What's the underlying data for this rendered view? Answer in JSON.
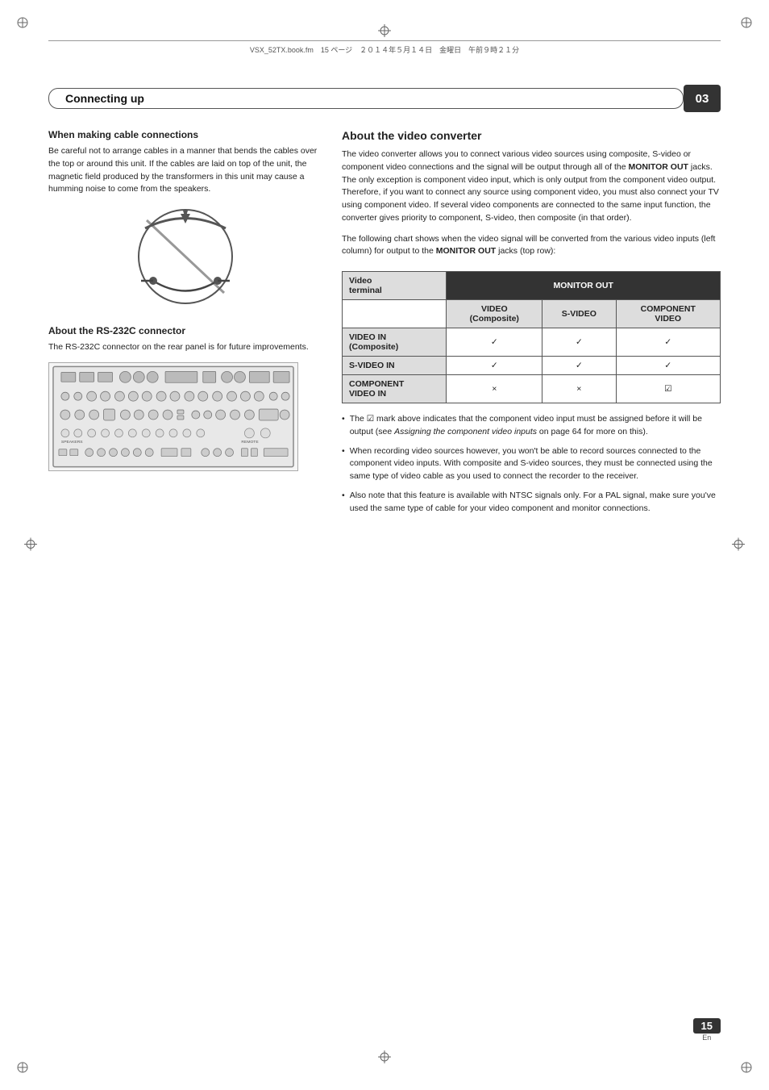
{
  "page": {
    "file_info": "VSX_52TX.book.fm　15 ページ　２０１４年５月１４日　金曜日　午前９時２１分",
    "section_title": "Connecting up",
    "section_number": "03",
    "page_number": "15",
    "page_locale": "En"
  },
  "left_column": {
    "cable_section_title": "When making cable connections",
    "cable_section_body": "Be careful not to arrange cables in a manner that bends the cables over the top or around this unit. If the cables are laid on top of the unit, the magnetic field produced by the transformers in this unit may cause a humming noise to come from the speakers.",
    "rs232c_section_title": "About the RS-232C connector",
    "rs232c_section_body": "The RS-232C connector on the rear panel is for future improvements."
  },
  "right_column": {
    "video_converter_title": "About the video converter",
    "video_converter_body1": "The video converter allows you to connect various video sources using composite, S-video or component video connections and the signal will be output through all of the ",
    "monitor_out_bold": "MONITOR OUT",
    "video_converter_body2": " jacks. The only exception is component video input, which is only output from the component video output. Therefore, if you want to connect any source using component video, you must also connect your TV using component video. If several video components are connected to the same input function, the converter gives priority to component, S-video, then composite (in that order).",
    "video_converter_body3": "The following chart shows when the video signal will be converted from the various video inputs (left column) for output to the ",
    "monitor_out_bold2": "MONITOR OUT",
    "video_converter_body4": " jacks (top row):",
    "table": {
      "header_video_terminal": "Video\nterminal",
      "header_monitor_out": "MONITOR OUT",
      "col_video_composite": "VIDEO\n(Composite)",
      "col_svideo": "S-VIDEO",
      "col_component_video": "COMPONENT\nVIDEO",
      "row_video_in": "VIDEO IN\n(Composite)",
      "row_svideo_in": "S-VIDEO IN",
      "row_component_video_in": "COMPONENT\nVIDEO IN",
      "check": "✓",
      "cross": "×",
      "checkbox": "☑"
    },
    "bullets": [
      "The ☑ mark above indicates that the component video input must be assigned before it will be output (see Assigning the component video inputs on page 64 for more on this).",
      "When recording video sources however, you won't be able to record sources connected to the component video inputs. With composite and S-video sources, they must be connected using the same type of video cable as you used to connect the recorder to the receiver.",
      "Also note that this feature is available with NTSC signals only. For a PAL signal, make sure you've used the same type of cable for your video component and monitor connections."
    ]
  }
}
